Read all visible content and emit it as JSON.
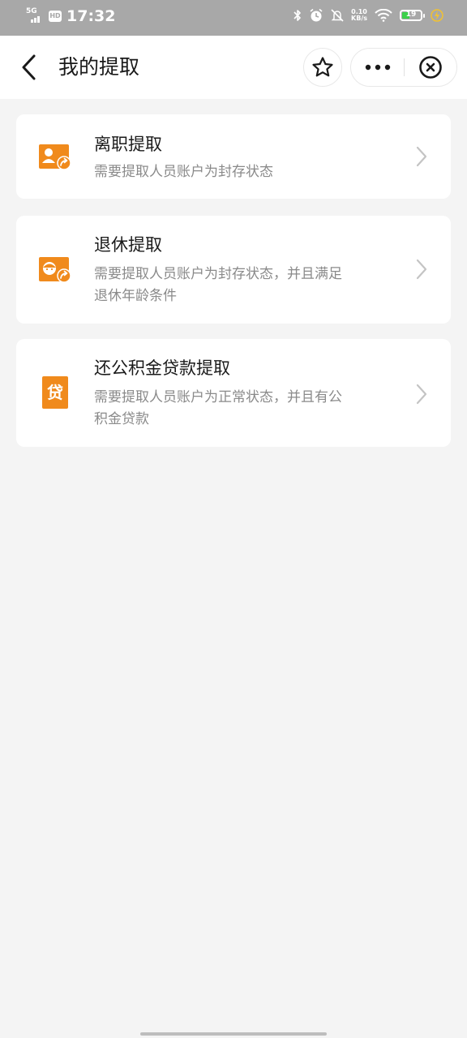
{
  "status_bar": {
    "network": "5G",
    "hd": "HD",
    "time": "17:32",
    "speed_value": "0.10",
    "speed_unit": "KB/s",
    "battery": "19",
    "battery_color": "#3cd04a",
    "icons": [
      "bluetooth-icon",
      "alarm-icon",
      "mute-icon",
      "wifi-icon",
      "charging-icon"
    ]
  },
  "nav": {
    "title": "我的提取",
    "back_icon": "chevron-left-icon",
    "favorite_icon": "star-icon",
    "more_icon": "more-dots-icon",
    "close_icon": "close-circle-icon"
  },
  "items": [
    {
      "icon": "resign-icon",
      "title": "离职提取",
      "desc": "需要提取人员账户为封存状态"
    },
    {
      "icon": "retire-icon",
      "title": "退休提取",
      "desc": "需要提取人员账户为封存状态，并且满足退休年龄条件"
    },
    {
      "icon": "loan-icon",
      "icon_text": "贷",
      "title": "还公积金贷款提取",
      "desc": "需要提取人员账户为正常状态，并且有公积金贷款"
    }
  ],
  "colors": {
    "accent": "#f08a1c",
    "background": "#f4f4f4",
    "card": "#ffffff",
    "title_text": "#1a1a1a",
    "desc_text": "#8a8a8a"
  }
}
